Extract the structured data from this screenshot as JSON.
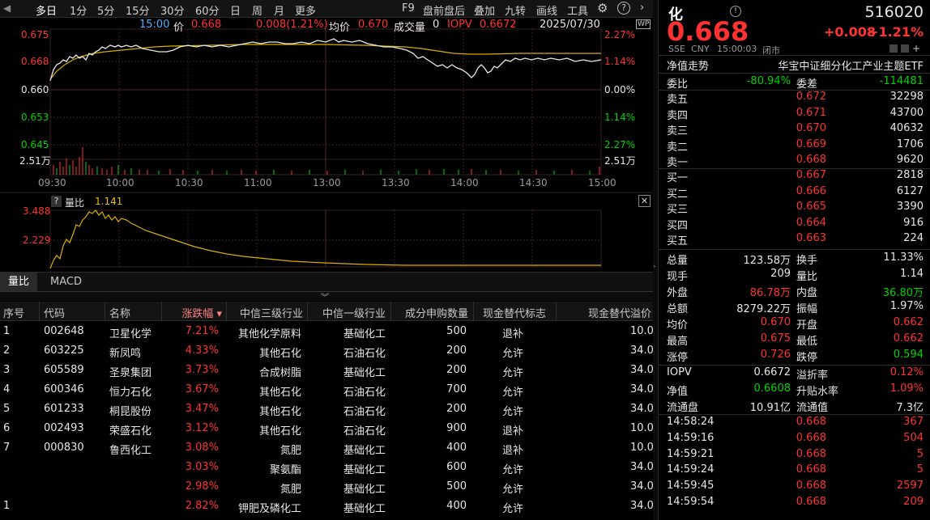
{
  "toolbar": {
    "left_items": [
      "多日",
      "1分",
      "5分",
      "15分",
      "30分",
      "60分",
      "日",
      "周",
      "月",
      "更多"
    ],
    "right_items": [
      "F9",
      "盘前盘后",
      "叠加",
      "九转",
      "画线",
      "工具"
    ]
  },
  "quote_bar": {
    "time": "15:00",
    "price_label": "价",
    "price": "0.668",
    "change": "0.008(1.21%)",
    "avg_label": "均价",
    "avg": "0.670",
    "volume_label": "成交量",
    "volume": "0",
    "iopv_label": "IOPV",
    "iopv": "0.6672",
    "date": "2025/07/30",
    "wp_label": "WP"
  },
  "price_axis_left": [
    "0.675",
    "0.668",
    "0.660",
    "0.653",
    "0.645"
  ],
  "price_axis_right": [
    "2.27%",
    "1.14%",
    "0.00%",
    "1.14%",
    "2.27%"
  ],
  "vol_axis": "2.51万",
  "time_axis": [
    "09:30",
    "10:00",
    "10:30",
    "11:00",
    "13:00",
    "13:30",
    "14:00",
    "14:30",
    "15:00"
  ],
  "ratio_panel": {
    "help": "?",
    "label": "量比",
    "value": "1.141",
    "axis_top": "3.488",
    "axis_mid": "2.229"
  },
  "tabs": [
    "量比",
    "MACD"
  ],
  "table": {
    "headers": [
      "序号",
      "代码",
      "名称",
      "涨跌幅 ▾",
      "中信三级行业",
      "中信一级行业",
      "成分申购数量",
      "现金替代标志",
      "现金替代溢价"
    ],
    "rows": [
      {
        "no": "1",
        "code": "002648",
        "name": "卫星化学",
        "chg": "7.21%",
        "l3": "其他化学原料",
        "l1": "基础化工",
        "qty": "500",
        "flag": "退补",
        "prem": "10.0"
      },
      {
        "no": "2",
        "code": "603225",
        "name": "新凤鸣",
        "chg": "4.33%",
        "l3": "其他石化",
        "l1": "石油石化",
        "qty": "200",
        "flag": "允许",
        "prem": "34.0"
      },
      {
        "no": "3",
        "code": "605589",
        "name": "圣泉集团",
        "chg": "3.73%",
        "l3": "合成树脂",
        "l1": "基础化工",
        "qty": "200",
        "flag": "允许",
        "prem": "34.0"
      },
      {
        "no": "4",
        "code": "600346",
        "name": "恒力石化",
        "chg": "3.67%",
        "l3": "其他石化",
        "l1": "石油石化",
        "qty": "700",
        "flag": "允许",
        "prem": "34.0"
      },
      {
        "no": "5",
        "code": "601233",
        "name": "桐昆股份",
        "chg": "3.47%",
        "l3": "其他石化",
        "l1": "石油石化",
        "qty": "200",
        "flag": "允许",
        "prem": "34.0"
      },
      {
        "no": "6",
        "code": "002493",
        "name": "荣盛石化",
        "chg": "3.12%",
        "l3": "其他石化",
        "l1": "石油石化",
        "qty": "900",
        "flag": "退补",
        "prem": "10.0"
      },
      {
        "no": "7",
        "code": "000830",
        "name": "鲁西化工",
        "chg": "3.08%",
        "l3": "氮肥",
        "l1": "基础化工",
        "qty": "400",
        "flag": "退补",
        "prem": "10.0"
      },
      {
        "no": "",
        "code": "",
        "name": "",
        "chg": "3.03%",
        "l3": "聚氨酯",
        "l1": "基础化工",
        "qty": "600",
        "flag": "允许",
        "prem": "34.0"
      },
      {
        "no": "",
        "code": "",
        "name": "",
        "chg": "2.98%",
        "l3": "氮肥",
        "l1": "基础化工",
        "qty": "500",
        "flag": "允许",
        "prem": "34.0"
      },
      {
        "no": "1",
        "code": "",
        "name": "",
        "chg": "2.82%",
        "l3": "钾肥及磷化工",
        "l1": "基础化工",
        "qty": "400",
        "flag": "允许",
        "prem": "34.0"
      }
    ]
  },
  "panel": {
    "name_char": "化",
    "code": "516020",
    "price": "0.668",
    "change": "+0.008",
    "change_pct": "+1.21%",
    "market": "SSE",
    "currency": "CNY",
    "time": "15:00:03",
    "status": "闭市",
    "nav_trend_label": "净值走势",
    "fund_name": "华宝中证细分化工产业主题ETF",
    "weibi_label": "委比",
    "weibi": "-80.94%",
    "weicha_label": "委差",
    "weicha": "-114481",
    "asks": [
      {
        "label": "卖五",
        "price": "0.672",
        "vol": "32298"
      },
      {
        "label": "卖四",
        "price": "0.671",
        "vol": "43700"
      },
      {
        "label": "卖三",
        "price": "0.670",
        "vol": "40632"
      },
      {
        "label": "卖二",
        "price": "0.669",
        "vol": "1706"
      },
      {
        "label": "卖一",
        "price": "0.668",
        "vol": "9620"
      }
    ],
    "bids": [
      {
        "label": "买一",
        "price": "0.667",
        "vol": "2818"
      },
      {
        "label": "买二",
        "price": "0.666",
        "vol": "6127"
      },
      {
        "label": "买三",
        "price": "0.665",
        "vol": "3390"
      },
      {
        "label": "买四",
        "price": "0.664",
        "vol": "916"
      },
      {
        "label": "买五",
        "price": "0.663",
        "vol": "224"
      }
    ],
    "stats": [
      {
        "l1": "总量",
        "v1": "123.58万",
        "c1": "white",
        "l2": "换手",
        "v2": "11.33%",
        "c2": "white"
      },
      {
        "l1": "现手",
        "v1": "209",
        "c1": "white",
        "l2": "量比",
        "v2": "1.14",
        "c2": "white"
      },
      {
        "l1": "外盘",
        "v1": "86.78万",
        "c1": "red",
        "l2": "内盘",
        "v2": "36.80万",
        "c2": "green"
      },
      {
        "l1": "总额",
        "v1": "8279.22万",
        "c1": "white",
        "l2": "振幅",
        "v2": "1.97%",
        "c2": "white"
      },
      {
        "l1": "均价",
        "v1": "0.670",
        "c1": "red",
        "l2": "开盘",
        "v2": "0.662",
        "c2": "red"
      },
      {
        "l1": "最高",
        "v1": "0.675",
        "c1": "red",
        "l2": "最低",
        "v2": "0.662",
        "c2": "red"
      },
      {
        "l1": "涨停",
        "v1": "0.726",
        "c1": "red",
        "l2": "跌停",
        "v2": "0.594",
        "c2": "green"
      }
    ],
    "stats2": [
      {
        "l1": "IOPV",
        "v1": "0.6672",
        "c1": "white",
        "l2": "溢折率",
        "v2": "0.12%",
        "c2": "red"
      },
      {
        "l1": "净值",
        "v1": "0.6608",
        "c1": "green",
        "l2": "升贴水率",
        "v2": "1.09%",
        "c2": "red"
      },
      {
        "l1": "流通盘",
        "v1": "10.91亿",
        "c1": "white",
        "l2": "流通值",
        "v2": "7.3亿",
        "c2": "white"
      }
    ],
    "ticks": [
      {
        "time": "14:58:24",
        "price": "0.668",
        "vol": "367"
      },
      {
        "time": "14:59:16",
        "price": "0.668",
        "vol": "504"
      },
      {
        "time": "14:59:21",
        "price": "0.668",
        "vol": "5"
      },
      {
        "time": "14:59:24",
        "price": "0.668",
        "vol": "5"
      },
      {
        "time": "14:59:45",
        "price": "0.668",
        "vol": "2597"
      },
      {
        "time": "14:59:54",
        "price": "0.668",
        "vol": "209"
      }
    ]
  }
}
